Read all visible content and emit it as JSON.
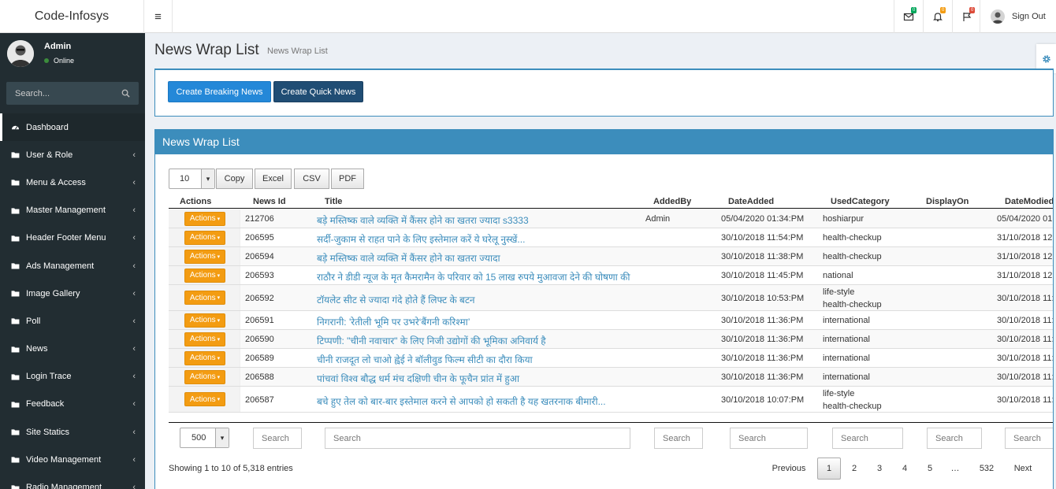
{
  "app": {
    "logo": "Code-Infosys",
    "menu_toggle": "≡"
  },
  "topbar": {
    "badges": {
      "messages": "0",
      "notifications": "0",
      "flags": "0"
    },
    "signout": "Sign Out",
    "colors": {
      "messages_badge": "#00a65a",
      "notifications_badge": "#f39c12",
      "flags_badge": "#dd4b39"
    }
  },
  "sidebar": {
    "user": {
      "name": "Admin",
      "status": "Online"
    },
    "search_placeholder": "Search...",
    "items": [
      {
        "label": "Dashboard"
      },
      {
        "label": "User & Role"
      },
      {
        "label": "Menu & Access"
      },
      {
        "label": "Master Management"
      },
      {
        "label": "Header Footer Menu"
      },
      {
        "label": "Ads Management"
      },
      {
        "label": "Image Gallery"
      },
      {
        "label": "Poll"
      },
      {
        "label": "News"
      },
      {
        "label": "Login Trace"
      },
      {
        "label": "Feedback"
      },
      {
        "label": "Site Statics"
      },
      {
        "label": "Video Management"
      },
      {
        "label": "Radio Management"
      }
    ]
  },
  "page": {
    "title": "News Wrap List",
    "subtitle": "News Wrap List"
  },
  "buttons": {
    "breaking": "Create Breaking News",
    "quick": "Create Quick News"
  },
  "table": {
    "box_title": "News Wrap List",
    "page_length": "10",
    "export_buttons": [
      "Copy",
      "Excel",
      "CSV",
      "PDF"
    ],
    "columns": [
      "Actions",
      "News Id",
      "Title",
      "AddedBy",
      "DateAdded",
      "UsedCategory",
      "DisplayOn",
      "DateModied"
    ],
    "action_label": "Actions",
    "rows": [
      {
        "id": "212706",
        "title": "बड़े मस्तिष्क वाले व्यक्ति में कैंसर होने का खतरा ज्यादा s3333",
        "added_by": "Admin",
        "date_added": "05/04/2020 01:34:PM",
        "category": [
          "hoshiarpur"
        ],
        "display_on": "",
        "date_modified": "05/04/2020 01:"
      },
      {
        "id": "206595",
        "title": "सर्दी-जुकाम से राहत पाने के लिए इस्तेमाल करें ये घरेलू नुस्खें...",
        "added_by": "",
        "date_added": "30/10/2018 11:54:PM",
        "category": [
          "health-checkup"
        ],
        "display_on": "",
        "date_modified": "31/10/2018 12:"
      },
      {
        "id": "206594",
        "title": "बड़े मस्तिष्क वाले व्यक्ति में कैंसर होने का खतरा ज्यादा",
        "added_by": "",
        "date_added": "30/10/2018 11:38:PM",
        "category": [
          "health-checkup"
        ],
        "display_on": "",
        "date_modified": "31/10/2018 12:"
      },
      {
        "id": "206593",
        "title": "राठौर ने डीडी न्यूज के मृत कैमरामैन के परिवार को 15 लाख रुपये मुआवजा देने की घोषणा की",
        "added_by": "",
        "date_added": "30/10/2018 11:45:PM",
        "category": [
          "national"
        ],
        "display_on": "",
        "date_modified": "31/10/2018 12:"
      },
      {
        "id": "206592",
        "title": "टॉयलेट सीट से ज्यादा गंदे होते हैं लिफ्ट के बटन",
        "added_by": "",
        "date_added": "30/10/2018 10:53:PM",
        "category": [
          "life-style",
          "health-checkup"
        ],
        "display_on": "",
        "date_modified": "30/10/2018 11:"
      },
      {
        "id": "206591",
        "title": "निगरानी: 'रेतीली भूमि पर उभरे‘बैंगनी करिश्मा’",
        "added_by": "",
        "date_added": "30/10/2018 11:36:PM",
        "category": [
          "international"
        ],
        "display_on": "",
        "date_modified": "30/10/2018 11:"
      },
      {
        "id": "206590",
        "title": "टिप्पणी: \"चीनी नवाचार\" के लिए निजी उद्योगों की भूमिका अनिवार्य है",
        "added_by": "",
        "date_added": "30/10/2018 11:36:PM",
        "category": [
          "international"
        ],
        "display_on": "",
        "date_modified": "30/10/2018 11:"
      },
      {
        "id": "206589",
        "title": "चीनी राजदूत लो चाओ ह्वेई ने बॉलीवुड फिल्म सीटी का दौरा किया",
        "added_by": "",
        "date_added": "30/10/2018 11:36:PM",
        "category": [
          "international"
        ],
        "display_on": "",
        "date_modified": "30/10/2018 11:"
      },
      {
        "id": "206588",
        "title": "पांचवां विश्व बौद्ध धर्म मंच दक्षिणी चीन के फूचैन प्रांत में हुआ",
        "added_by": "",
        "date_added": "30/10/2018 11:36:PM",
        "category": [
          "international"
        ],
        "display_on": "",
        "date_modified": "30/10/2018 11:"
      },
      {
        "id": "206587",
        "title": "बचे हुए तेल को बार-बार इस्तेमाल करने से आपको हो सकती है यह खतरनाक बीमारी...",
        "added_by": "",
        "date_added": "30/10/2018 10:07:PM",
        "category": [
          "life-style",
          "health-checkup"
        ],
        "display_on": "",
        "date_modified": "30/10/2018 11:"
      }
    ],
    "footer": {
      "page_length": "500",
      "search_placeholder": "Search"
    },
    "info": "Showing 1 to 10 of 5,318 entries",
    "pagination": {
      "previous": "Previous",
      "pages": [
        "1",
        "2",
        "3",
        "4",
        "5",
        "…",
        "532"
      ],
      "next": "Next",
      "current": "1"
    }
  }
}
